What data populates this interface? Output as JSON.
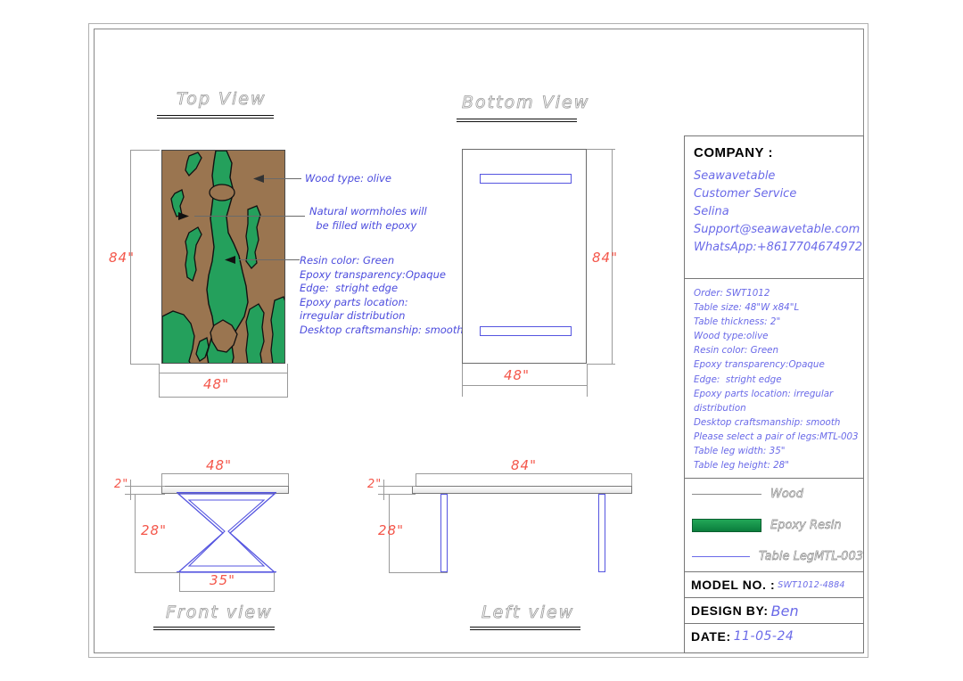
{
  "sheet": {
    "background": "#ffffff",
    "frame_color": "#888888"
  },
  "colors": {
    "wood": "#9a7550",
    "resin_green": "#22a757",
    "resin_green_dark": "#0b7d3d",
    "leg_blue": "#5555e0",
    "note_blue": "#4b4bdd",
    "dimension_red": "#f4564a",
    "title_gray": "#9a9a9a"
  },
  "views": {
    "top": {
      "title": "Top View",
      "dim_height": "84\"",
      "dim_width": "48\""
    },
    "bottom": {
      "title": "Bottom View",
      "dim_height": "84\"",
      "dim_width": "48\""
    },
    "front": {
      "title": "Front view",
      "dim_width": "48\"",
      "dim_thickness": "2\"",
      "dim_height": "28\"",
      "dim_leg_width": "35\""
    },
    "left": {
      "title": "Left view",
      "dim_length": "84\"",
      "dim_thickness": "2\"",
      "dim_height": "28\""
    }
  },
  "annotations": [
    {
      "name": "wood-type",
      "lines": [
        "Wood type: olive"
      ]
    },
    {
      "name": "wormholes",
      "lines": [
        "Natural wormholes will",
        "  be filled with epoxy"
      ]
    },
    {
      "name": "resin-specs",
      "lines": [
        "Resin color: Green",
        "Epoxy transparency:Opaque",
        "Edge:  stright edge",
        "Epoxy parts location:",
        "irregular distribution",
        "Desktop craftsmanship: smooth"
      ]
    }
  ],
  "title_block": {
    "company": {
      "heading": "COMPANY :",
      "lines": [
        "Seawavetable",
        "Customer Service",
        "Selina",
        "Support@seawavetable.com",
        "WhatsApp:+8617704674972"
      ]
    },
    "specs": [
      "Order: SWT1012",
      "Table size: 48\"W x84\"L",
      "Table thickness: 2\"",
      "Wood type:olive",
      "Resin color: Green",
      "Epoxy transparency:Opaque",
      "Edge:  stright edge",
      "Epoxy parts location: irregular",
      "distribution",
      "Desktop craftsmanship: smooth",
      "Please select a pair of legs:MTL-003",
      "Table leg width: 35\"",
      "Table leg height: 28\""
    ],
    "legend": [
      {
        "swatch": "wood-line",
        "label": "Wood"
      },
      {
        "swatch": "resin-block",
        "label": "Epoxy Resin"
      },
      {
        "swatch": "leg-line",
        "label": "Table LegMTL-003"
      }
    ],
    "fields": [
      {
        "key": "MODEL  NO. :",
        "value": "SWT1012-4884",
        "name": "model-no"
      },
      {
        "key": "DESIGN BY:",
        "value": "Ben",
        "name": "design-by"
      },
      {
        "key": "DATE:",
        "value": "11-05-24",
        "name": "date"
      }
    ]
  }
}
